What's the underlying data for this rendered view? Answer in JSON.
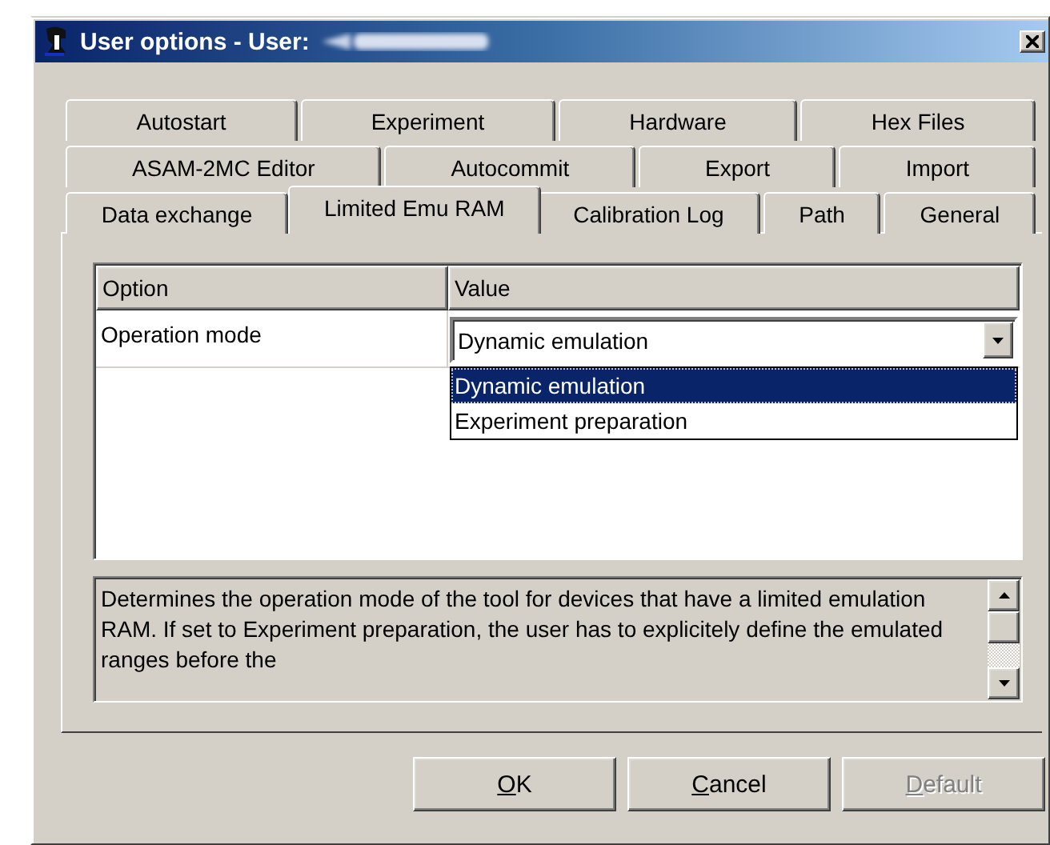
{
  "window": {
    "title": "User options - User:"
  },
  "tab_rows": [
    [
      {
        "label": "Autostart",
        "selected": false
      },
      {
        "label": "Experiment",
        "selected": false
      },
      {
        "label": "Hardware",
        "selected": false
      },
      {
        "label": "Hex Files",
        "selected": false
      }
    ],
    [
      {
        "label": "ASAM-2MC Editor",
        "selected": false
      },
      {
        "label": "Autocommit",
        "selected": false
      },
      {
        "label": "Export",
        "selected": false
      },
      {
        "label": "Import",
        "selected": false
      }
    ],
    [
      {
        "label": "Data exchange",
        "selected": false
      },
      {
        "label": "Limited Emu RAM",
        "selected": true
      },
      {
        "label": "Calibration Log",
        "selected": false
      },
      {
        "label": "Path",
        "selected": false
      },
      {
        "label": "General",
        "selected": false
      }
    ]
  ],
  "table": {
    "columns": [
      "Option",
      "Value"
    ],
    "rows": [
      {
        "option": "Operation mode",
        "value": "Dynamic emulation",
        "expanded": true,
        "choices": [
          {
            "label": "Dynamic emulation",
            "selected": true
          },
          {
            "label": "Experiment preparation",
            "selected": false
          }
        ]
      }
    ]
  },
  "description": "Determines the operation mode of the tool for devices that have a limited emulation RAM. If set to Experiment preparation, the user has to explicitely define the emulated ranges before the",
  "buttons": [
    {
      "label": "OK",
      "disabled": false
    },
    {
      "label": "Cancel",
      "disabled": false
    },
    {
      "label": "Default",
      "disabled": true
    }
  ]
}
